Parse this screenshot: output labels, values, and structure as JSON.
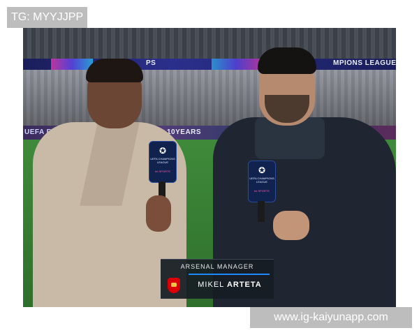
{
  "watermarks": {
    "top": "TG: MYYJJPP",
    "bottom": "www.ig-kaiyunapp.com"
  },
  "stadium": {
    "board_left_text": "PS",
    "board_right_text": "MPIONS LEAGUE",
    "ad_board_left": "UEFA FOUNDA",
    "ad_board_center": "10YEARS"
  },
  "microphones": {
    "label": "UEFA CHAMPIONS LEAGUE",
    "sponsor": "tnt SPORTS",
    "star": "✪"
  },
  "lower_third": {
    "role": "ARSENAL MANAGER",
    "first_name": "MIKEL",
    "last_name": "ARTETA"
  },
  "colors": {
    "pitch": "#3f8a3a",
    "lower_third_accent": "#1e88ff",
    "crest_red": "#db0007"
  }
}
